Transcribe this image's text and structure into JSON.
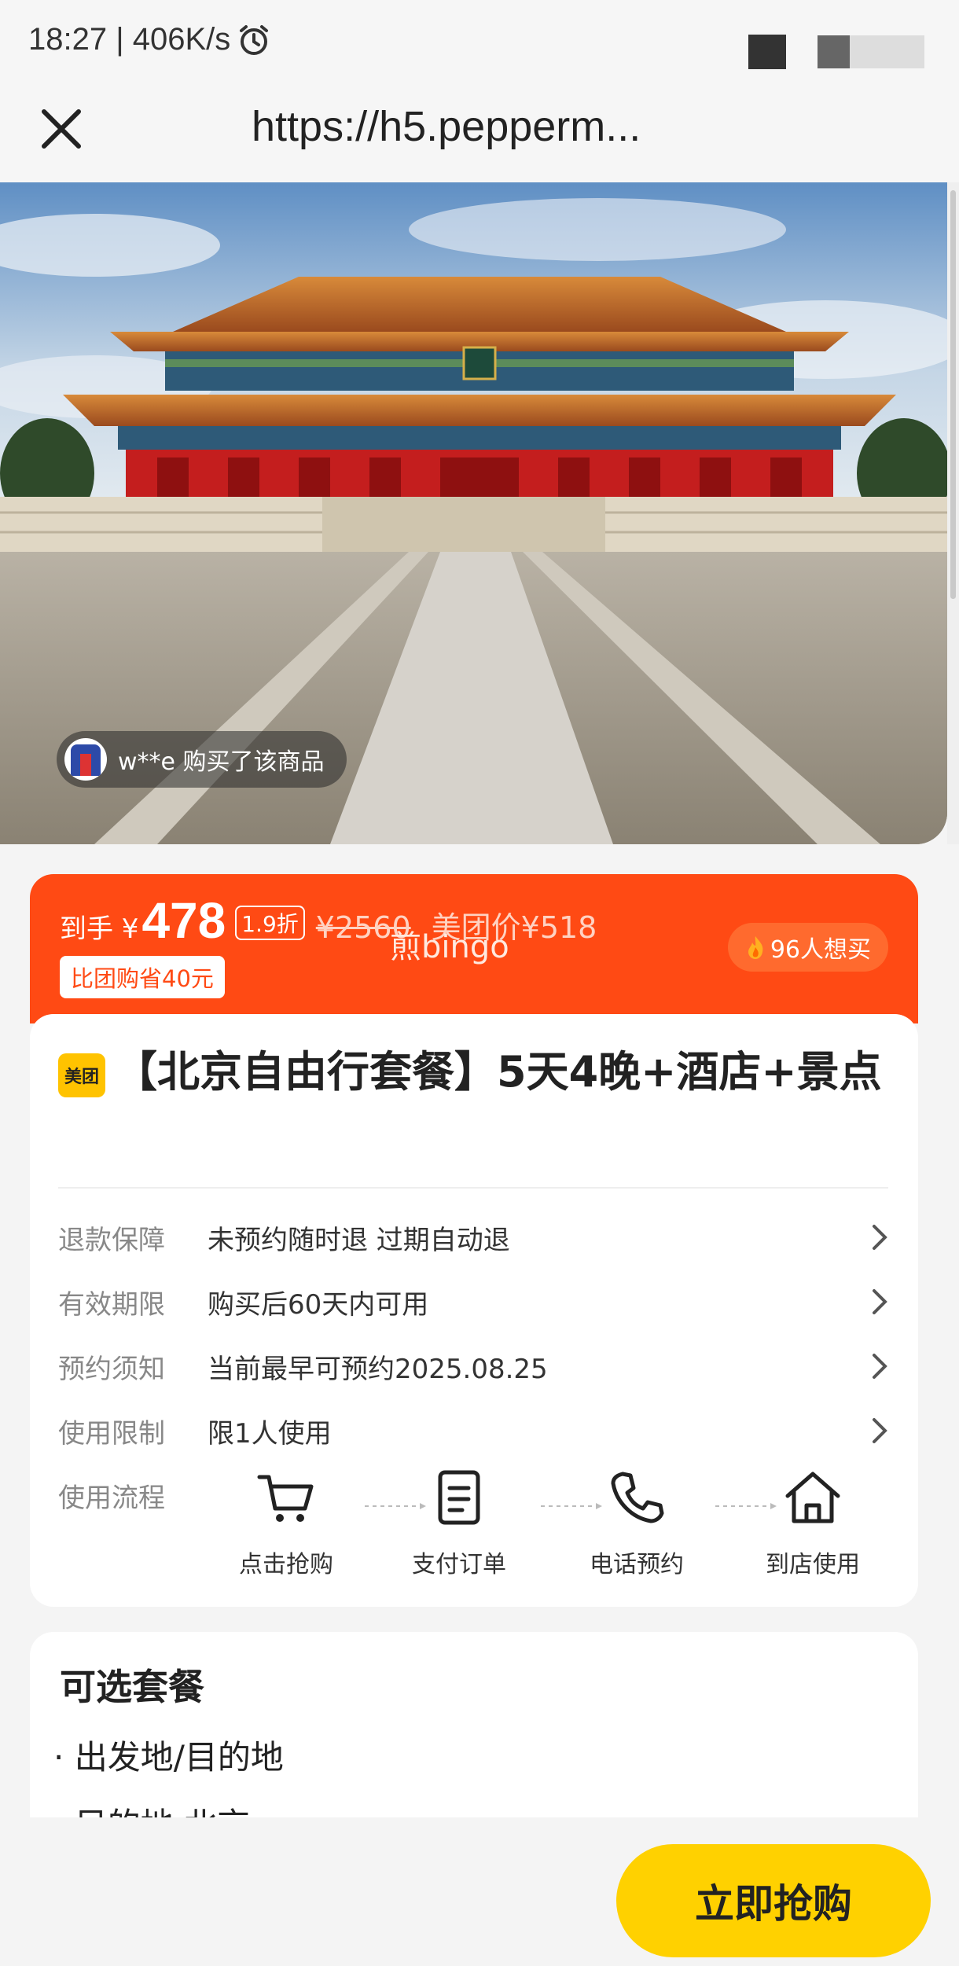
{
  "status_bar": {
    "time_speed": "18:27 | 406K/s"
  },
  "nav": {
    "url": "https://h5.pepperm..."
  },
  "hero": {
    "buyer_text": "w**e 购买了该商品"
  },
  "price": {
    "prefix": "到手 ¥",
    "amount": "478",
    "discount": "1.9折",
    "original": "¥2560",
    "meituan_price": "美团价¥518",
    "save_tag": "比团购省40元",
    "watermark": "煎bingo",
    "want_count": "96人想买"
  },
  "product": {
    "brand": "美团",
    "title": "【北京自由行套餐】5天4晚+酒店+景点"
  },
  "info_rows": [
    {
      "label": "退款保障",
      "value": "未预约随时退 过期自动退"
    },
    {
      "label": "有效期限",
      "value": "购买后60天内可用"
    },
    {
      "label": "预约须知",
      "value": "当前最早可预约2025.08.25"
    },
    {
      "label": "使用限制",
      "value": "限1人使用"
    }
  ],
  "flow": {
    "label": "使用流程",
    "steps": [
      {
        "label": "点击抢购",
        "icon": "cart-icon"
      },
      {
        "label": "支付订单",
        "icon": "document-icon"
      },
      {
        "label": "电话预约",
        "icon": "phone-icon"
      },
      {
        "label": "到店使用",
        "icon": "home-icon"
      }
    ]
  },
  "packages": {
    "title": "可选套餐",
    "items": [
      "· 出发地/目的地",
      "· 目的地 北京"
    ]
  },
  "bottom": {
    "buy_label": "立即抢购"
  },
  "colors": {
    "accent_orange": "#ff4a14",
    "buy_yellow": "#ffd100"
  }
}
